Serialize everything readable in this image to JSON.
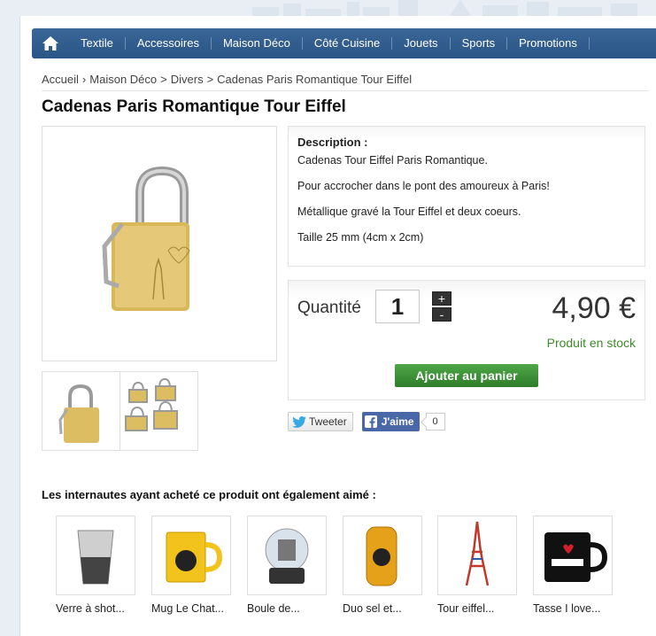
{
  "nav": {
    "home_icon": "home-icon",
    "items": [
      "Textile",
      "Accessoires",
      "Maison Déco",
      "Côté Cuisine",
      "Jouets",
      "Sports",
      "Promotions"
    ]
  },
  "breadcrumb": {
    "items": [
      "Accueil",
      "Maison Déco",
      "Divers",
      "Cadenas Paris Romantique Tour Eiffel"
    ],
    "separators": [
      "›",
      ">",
      ">"
    ]
  },
  "product": {
    "title": "Cadenas Paris Romantique Tour Eiffel",
    "description": {
      "heading": "Description :",
      "lines": [
        "Cadenas Tour Eiffel Paris Romantique.",
        "Pour accrocher dans le pont des amoureux à Paris!",
        "Métallique gravé la Tour Eiffel et deux coeurs.",
        "Taille 25 mm (4cm x 2cm)"
      ]
    },
    "quantity_label": "Quantité",
    "quantity_value": "1",
    "plus": "+",
    "minus": "-",
    "price": "4,90 €",
    "stock": "Produit en stock",
    "add_to_cart": "Ajouter au panier"
  },
  "social": {
    "tweet": "Tweeter",
    "like": "J'aime",
    "like_count": "0"
  },
  "also_bought": {
    "heading": "Les internautes ayant acheté ce produit ont également aimé :",
    "items": [
      "Verre à shot...",
      "Mug Le Chat...",
      "Boule de...",
      "Duo sel et...",
      "Tour eiffel...",
      "Tasse I love..."
    ]
  },
  "colors": {
    "nav": "#2f5b8c",
    "add_to_cart": "#3f9238",
    "stock": "#3f8a2a",
    "facebook": "#4a67a8"
  }
}
